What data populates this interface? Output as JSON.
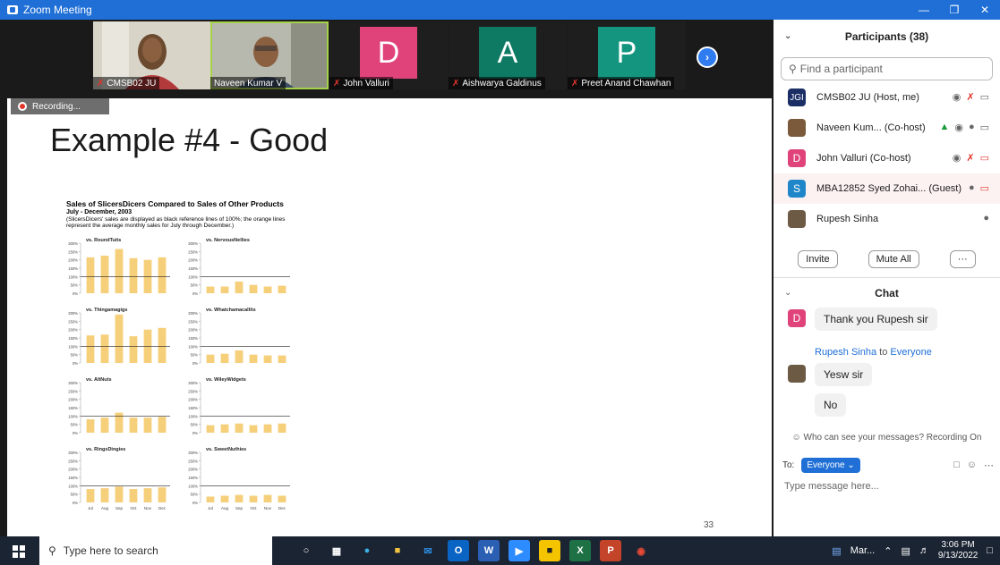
{
  "window": {
    "title": "Zoom Meeting"
  },
  "video_strip": {
    "tiles": [
      {
        "name": "CMSB02 JU",
        "kind": "video",
        "muted": true
      },
      {
        "name": "Naveen Kumar V",
        "kind": "video",
        "muted": false,
        "active": true
      },
      {
        "name": "John Valluri",
        "kind": "letter",
        "letter": "D",
        "color": "#e0437a",
        "muted": true
      },
      {
        "name": "Aishwarya Galdinus",
        "kind": "letter",
        "letter": "A",
        "color": "#0f7a63",
        "muted": true
      },
      {
        "name": "Preet Anand Chawhan",
        "kind": "letter",
        "letter": "P",
        "color": "#14957f",
        "muted": true
      }
    ]
  },
  "slide": {
    "recording_label": "Recording...",
    "title": "Example #4 - Good",
    "chart_title": "Sales of SlicersDicers Compared to Sales of Other Products",
    "chart_subtitle": "July - December, 2003",
    "chart_note": "(SlicersDicers' sales are displayed as black reference lines of 100%; the orange lines represent the average monthly sales for July through December.)",
    "page_number": "33"
  },
  "chart_data": {
    "type": "bar",
    "categories": [
      "Jul",
      "Aug",
      "Sep",
      "Oct",
      "Nov",
      "Dec"
    ],
    "ylim": [
      0,
      300
    ],
    "yticks": [
      "300%",
      "250%",
      "200%",
      "150%",
      "100%",
      "50%",
      "0%"
    ],
    "reference": 100,
    "panels": [
      {
        "name": "vs. RoundTuits",
        "values": [
          215,
          225,
          265,
          210,
          200,
          215
        ]
      },
      {
        "name": "vs. NervousNellies",
        "values": [
          40,
          40,
          70,
          50,
          40,
          45
        ]
      },
      {
        "name": "vs. Thingamagigs",
        "values": [
          165,
          170,
          290,
          160,
          200,
          210
        ]
      },
      {
        "name": "vs. Whatchamacallits",
        "values": [
          50,
          55,
          75,
          50,
          45,
          45
        ]
      },
      {
        "name": "vs. AltNuts",
        "values": [
          80,
          90,
          120,
          90,
          90,
          95
        ]
      },
      {
        "name": "vs. WileyWidgets",
        "values": [
          45,
          50,
          55,
          45,
          50,
          55
        ]
      },
      {
        "name": "vs. RingsDingies",
        "values": [
          80,
          85,
          95,
          80,
          85,
          90
        ]
      },
      {
        "name": "vs. SweetNuthies",
        "values": [
          35,
          40,
          45,
          40,
          45,
          40
        ]
      }
    ]
  },
  "participants": {
    "header": "Participants (38)",
    "search_placeholder": "Find a participant",
    "list": [
      {
        "avatar": "JGI",
        "avatar_color": "#1b2f66",
        "name": "CMSB02 JU (Host, me)"
      },
      {
        "avatar": "",
        "avatar_color": "#7a5a3a",
        "name": "Naveen Kum... (Co-host)"
      },
      {
        "avatar": "D",
        "avatar_color": "#e0437a",
        "name": "John Valluri (Co-host)"
      },
      {
        "avatar": "S",
        "avatar_color": "#1f87c9",
        "name": "MBA12852 Syed Zohai... (Guest)"
      },
      {
        "avatar": "",
        "avatar_color": "#6c5a45",
        "name": "Rupesh Sinha"
      }
    ],
    "invite": "Invite",
    "mute_all": "Mute All",
    "more": "···"
  },
  "chat": {
    "header": "Chat",
    "messages": [
      {
        "avatar": "D",
        "avatar_color": "#e0437a",
        "text": "Thank you Rupesh sir"
      },
      {
        "text": "Yesw sir"
      },
      {
        "text": "No"
      }
    ],
    "sender": "Rupesh Sinha",
    "to_word": "to",
    "recipient": "Everyone",
    "visibility_note": "Who can see your messages? Recording On",
    "to_label": "To:",
    "to_value": "Everyone",
    "input_placeholder": "Type message here..."
  },
  "taskbar": {
    "search_placeholder": "Type here to search",
    "active_window": "Mar...",
    "time": "3:06 PM",
    "date": "9/13/2022"
  }
}
